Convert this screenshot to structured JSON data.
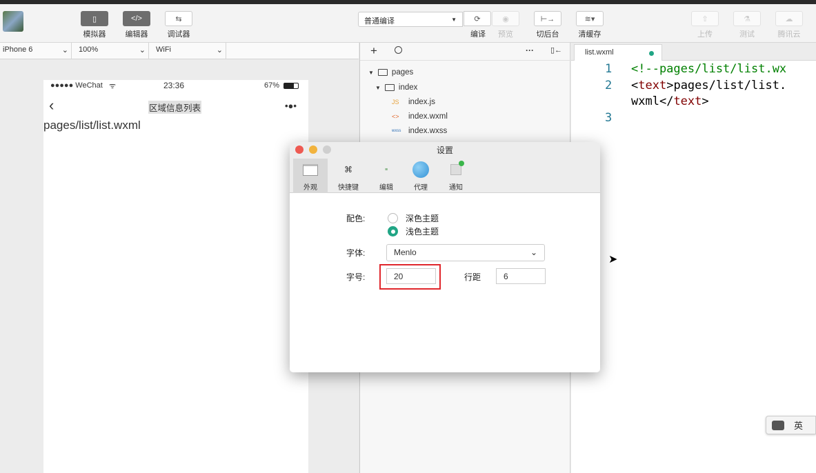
{
  "toolbar": {
    "left_buttons": [
      {
        "label": "模拟器",
        "icon": "phone-icon",
        "glyph": "▯"
      },
      {
        "label": "编辑器",
        "icon": "code-icon",
        "glyph": "</>"
      },
      {
        "label": "调试器",
        "icon": "debug-icon",
        "glyph": "⇆"
      }
    ],
    "compile_mode": "普通编译",
    "compile_label": "编译",
    "preview_label": "预览",
    "background_label": "切后台",
    "cache_label": "清缓存",
    "upload_label": "上传",
    "test_label": "测试",
    "cloud_label": "腾讯云"
  },
  "simulator": {
    "device": "iPhone 6",
    "zoom": "100%",
    "network": "WiFi",
    "status_carrier": "●●●●● WeChat",
    "status_time": "23:36",
    "status_battery": "67%",
    "nav_title": "区域信息列表",
    "nav_more": "•●•",
    "page_text": "pages/list/list.wxml"
  },
  "explorer": {
    "add": "+",
    "more": "···",
    "items": [
      {
        "label": "pages",
        "type": "folder",
        "depth": 0
      },
      {
        "label": "index",
        "type": "folder",
        "depth": 1
      },
      {
        "label": "index.js",
        "type": "js",
        "badge": "JS",
        "depth": 2
      },
      {
        "label": "index.wxml",
        "type": "wxml",
        "badge": "<>",
        "depth": 2
      },
      {
        "label": "index.wxss",
        "type": "wxss",
        "badge": "wxss",
        "depth": 2
      }
    ]
  },
  "editor": {
    "tab_name": "list.wxml",
    "line_numbers": [
      "1",
      "2",
      "3"
    ],
    "line1": "<!--pages/list/list.wx",
    "line2_tag_open": "text",
    "line2_body": "pages/list/list.",
    "line2_cont": "wxml",
    "line2_tag_close": "text"
  },
  "dialog": {
    "title": "设置",
    "tabs": [
      "外观",
      "快捷键",
      "编辑",
      "代理",
      "通知"
    ],
    "color_label": "配色:",
    "theme_options": [
      "深色主题",
      "浅色主题"
    ],
    "selected_theme": "浅色主题",
    "font_label": "字体:",
    "font_value": "Menlo",
    "size_label": "字号:",
    "size_value": "20",
    "line_height_label": "行距",
    "line_height_value": "6"
  },
  "ime": {
    "label": "英"
  },
  "colors": {
    "accent": "#20a585",
    "highlight": "#e0262b",
    "tag": "#800000",
    "string": "#008000"
  }
}
